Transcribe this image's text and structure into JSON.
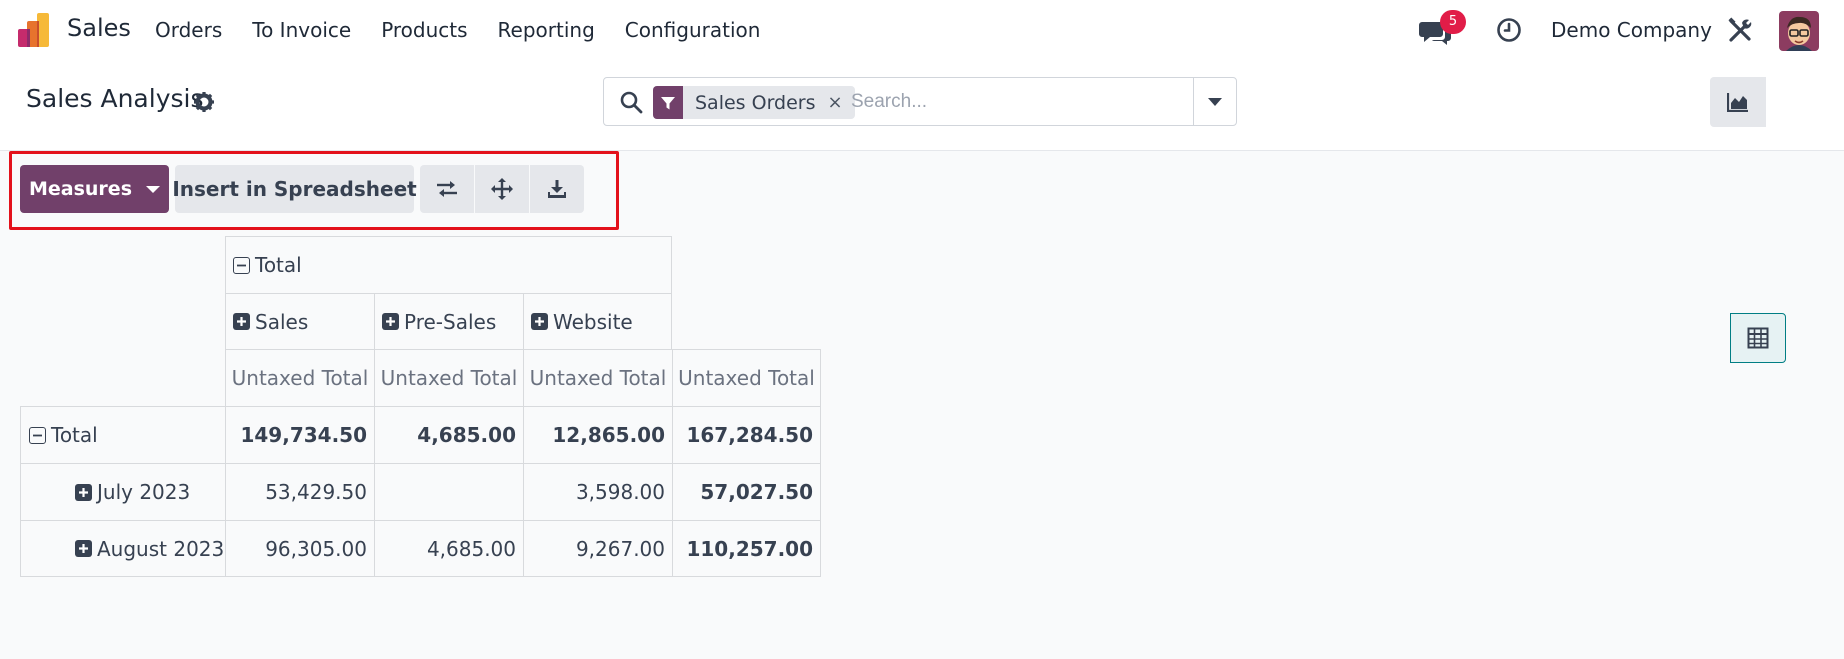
{
  "navbar": {
    "app_name": "Sales",
    "menu": [
      "Orders",
      "To Invoice",
      "Products",
      "Reporting",
      "Configuration"
    ],
    "notification_count": "5",
    "company": "Demo Company"
  },
  "control_panel": {
    "title": "Sales Analysis",
    "search": {
      "facet_label": "Sales Orders",
      "facet_remove": "×",
      "placeholder": "Search..."
    }
  },
  "toolbar": {
    "measures_label": "Measures",
    "insert_label": "Insert in Spreadsheet"
  },
  "pivot": {
    "col_header_total": "Total",
    "col_groups": [
      "Sales",
      "Pre-Sales",
      "Website"
    ],
    "measure_label": "Untaxed Total",
    "rows": [
      {
        "label": "Total",
        "values": [
          "149,734.50",
          "4,685.00",
          "12,865.00",
          "167,284.50"
        ]
      },
      {
        "label": "July 2023",
        "values": [
          "53,429.50",
          "",
          "3,598.00",
          "57,027.50"
        ]
      },
      {
        "label": "August 2023",
        "values": [
          "96,305.00",
          "4,685.00",
          "9,267.00",
          "110,257.00"
        ]
      }
    ]
  },
  "icons": {
    "app_logo": "sales-app-icon",
    "chat": "chat-bubbles-icon",
    "clock": "clock-icon",
    "tools": "debug-tools-icon",
    "settings": "gear-icon",
    "search": "search-icon",
    "filter": "filter-icon",
    "graph_view": "area-chart-icon",
    "pivot_view": "table-grid-icon",
    "flip_axis": "swap-arrows-icon",
    "expand_all": "move-arrows-icon",
    "download": "download-icon"
  },
  "colors": {
    "brand": "#71406a",
    "highlight_border": "#e3111b",
    "badge": "#e11d48",
    "active_view": "#017e84"
  }
}
